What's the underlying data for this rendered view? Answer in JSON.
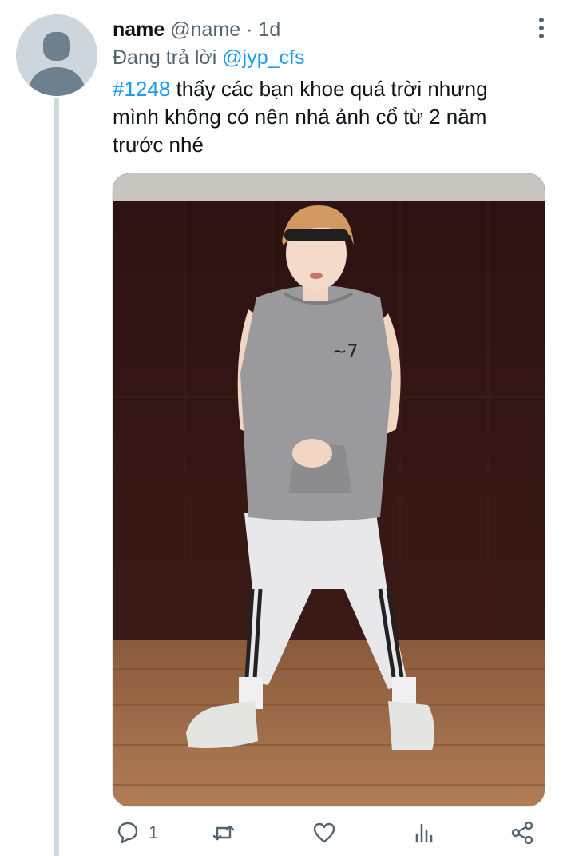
{
  "tweet": {
    "author_name": "name",
    "author_handle": "@name",
    "separator": "·",
    "time": "1d",
    "reply_prefix": "Đang trả lời",
    "reply_mention": "@jyp_cfs",
    "hashtag": "#1248",
    "text_line1": " thấy các bạn khoe quá trời nhưng",
    "text_line2": "mình không có nên nhả ảnh cổ từ 2 năm",
    "text_line3": "trước nhé"
  },
  "actions": {
    "reply_count": "1",
    "retweet_count": "",
    "like_count": ""
  },
  "icons": {
    "avatar": "default-avatar-icon",
    "more": "more-vertical-icon",
    "reply": "reply-icon",
    "retweet": "retweet-icon",
    "like": "heart-icon",
    "views": "analytics-icon",
    "share": "share-icon"
  },
  "colors": {
    "accent": "#1d9bf0",
    "secondary_text": "#536471",
    "thread_line": "#cfd9de"
  }
}
